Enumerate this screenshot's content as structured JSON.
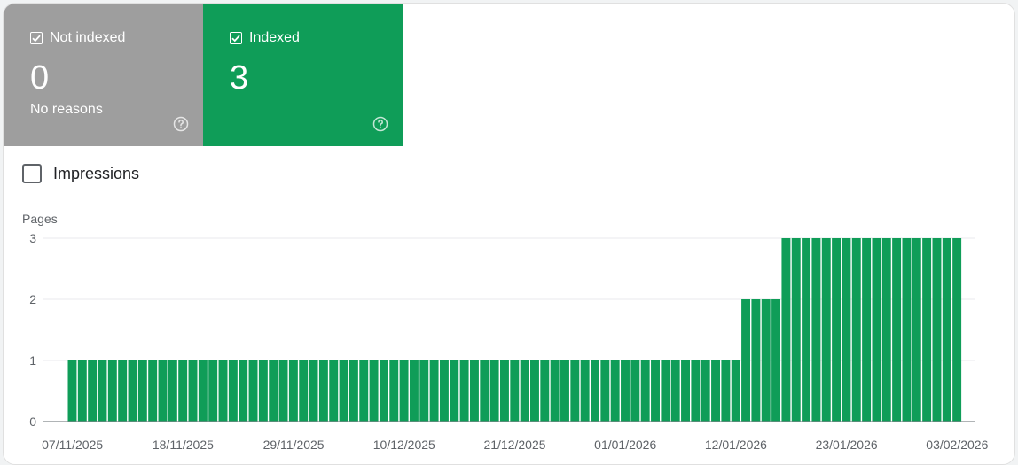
{
  "tiles": {
    "not_indexed": {
      "label": "Not indexed",
      "count": "0",
      "sub": "No reasons",
      "color": "#9e9e9e",
      "checked": true
    },
    "indexed": {
      "label": "Indexed",
      "count": "3",
      "sub": "",
      "color": "#0f9d58",
      "checked": true
    }
  },
  "impressions": {
    "label": "Impressions",
    "checked": false
  },
  "chart_data": {
    "type": "bar",
    "ylabel": "Pages",
    "ylim": [
      0,
      3
    ],
    "yticks": [
      0,
      1,
      2,
      3
    ],
    "bar_color": "#0f9d58",
    "x_tick_labels": [
      "07/11/2025",
      "18/11/2025",
      "29/11/2025",
      "10/12/2025",
      "21/12/2025",
      "01/01/2026",
      "12/01/2026",
      "23/01/2026",
      "03/02/2026"
    ],
    "x_tick_every": 11,
    "start_date": "07/11/2025",
    "values": [
      1,
      1,
      1,
      1,
      1,
      1,
      1,
      1,
      1,
      1,
      1,
      1,
      1,
      1,
      1,
      1,
      1,
      1,
      1,
      1,
      1,
      1,
      1,
      1,
      1,
      1,
      1,
      1,
      1,
      1,
      1,
      1,
      1,
      1,
      1,
      1,
      1,
      1,
      1,
      1,
      1,
      1,
      1,
      1,
      1,
      1,
      1,
      1,
      1,
      1,
      1,
      1,
      1,
      1,
      1,
      1,
      1,
      1,
      1,
      1,
      1,
      1,
      1,
      1,
      1,
      1,
      1,
      2,
      2,
      2,
      2,
      3,
      3,
      3,
      3,
      3,
      3,
      3,
      3,
      3,
      3,
      3,
      3,
      3,
      3,
      3,
      3,
      3,
      3
    ]
  }
}
